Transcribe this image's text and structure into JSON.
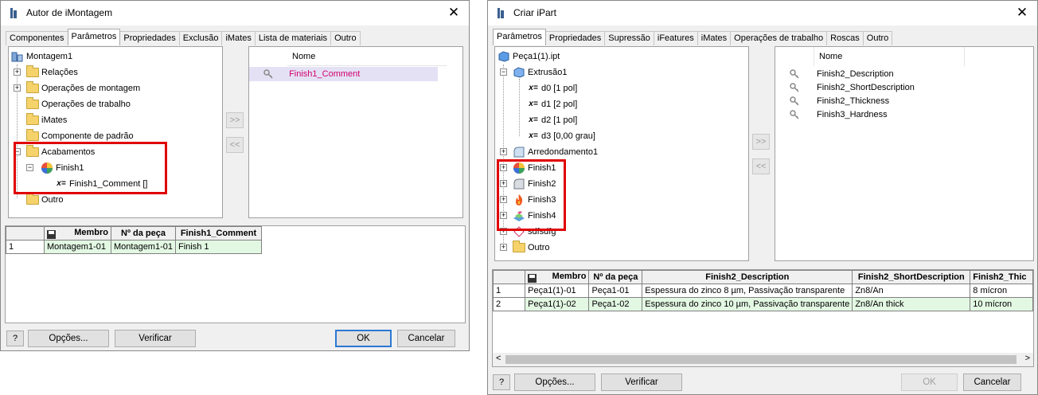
{
  "left_window": {
    "title": "Autor de iMontagem",
    "close_label": "✕",
    "tabs": [
      "Componentes",
      "Parâmetros",
      "Propriedades",
      "Exclusão",
      "iMates",
      "Lista de materiais",
      "Outro"
    ],
    "active_tab": "Parâmetros",
    "tree": {
      "root": "Montagem1",
      "items": [
        "Relações",
        "Operações de montagem",
        "Operações de trabalho",
        "iMates",
        "Componente de padrão",
        "Acabamentos",
        "Finish1",
        "Finish1_Comment []",
        "Outro"
      ]
    },
    "add_button": ">>",
    "remove_button": "<<",
    "list_header": "Nome",
    "list_items": [
      "Finish1_Comment"
    ],
    "table": {
      "headers": [
        "Membro",
        "Nº da peça",
        "Finish1_Comment"
      ],
      "rows": [
        [
          "1",
          "Montagem1-01",
          "Montagem1-01",
          "Finish 1"
        ]
      ]
    },
    "buttons": {
      "help": "?",
      "options": "Opções...",
      "verify": "Verificar",
      "ok": "OK",
      "cancel": "Cancelar"
    }
  },
  "right_window": {
    "title": "Criar iPart",
    "close_label": "✕",
    "tabs": [
      "Parâmetros",
      "Propriedades",
      "Supressão",
      "iFeatures",
      "iMates",
      "Operações de trabalho",
      "Roscas",
      "Outro"
    ],
    "active_tab": "Parâmetros",
    "tree": {
      "root": "Peça1(1).ipt",
      "items": [
        "Extrusão1",
        "d0 [1 pol]",
        "d1 [2 pol]",
        "d2 [1 pol]",
        "d3 [0,00 grau]",
        "Arredondamento1",
        "Finish1",
        "Finish2",
        "Finish3",
        "Finish4",
        "sdfsdfg",
        "Outro"
      ]
    },
    "add_button": ">>",
    "remove_button": "<<",
    "list_header": "Nome",
    "list_items": [
      "Finish2_Description",
      "Finish2_ShortDescription",
      "Finish2_Thickness",
      "Finish3_Hardness"
    ],
    "table": {
      "headers": [
        "Membro",
        "Nº da peça",
        "Finish2_Description",
        "Finish2_ShortDescription",
        "Finish2_Thic"
      ],
      "rows": [
        [
          "1",
          "Peça1(1)-01",
          "Peça1-01",
          "Espessura do zinco 8 µm, Passivação transparente",
          "Zn8/An",
          "8 mícron"
        ],
        [
          "2",
          "Peça1(1)-02",
          "Peça1-02",
          "Espessura do zinco 10 µm, Passivação transparente",
          "Zn8/An thick",
          "10 mícron"
        ]
      ]
    },
    "scroll_left": "<",
    "scroll_right": ">",
    "buttons": {
      "help": "?",
      "options": "Opções...",
      "verify": "Verificar",
      "ok": "OK",
      "cancel": "Cancelar"
    }
  },
  "colors": {
    "highlight_box": "#e00000",
    "selected_text": "#d0006f",
    "green_cell": "#e3f8e3",
    "default_button_border": "#2b78d4"
  }
}
